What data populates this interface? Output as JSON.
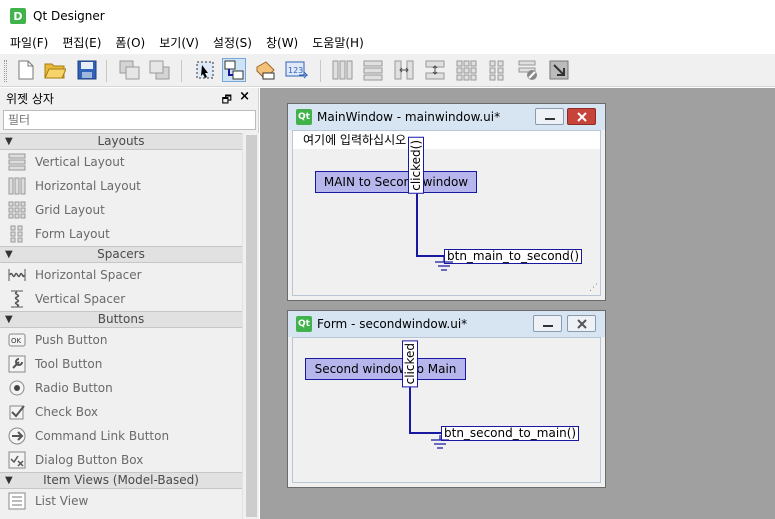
{
  "window": {
    "title": "Qt Designer",
    "icon": "D"
  },
  "menubar": [
    "파일(F)",
    "편집(E)",
    "폼(O)",
    "보기(V)",
    "설정(S)",
    "창(W)",
    "도움말(H)"
  ],
  "widget_box": {
    "title": "위젯 상자",
    "filter_placeholder": "필터",
    "categories": [
      {
        "label": "Layouts",
        "items": [
          "Vertical Layout",
          "Horizontal Layout",
          "Grid Layout",
          "Form Layout"
        ]
      },
      {
        "label": "Spacers",
        "items": [
          "Horizontal Spacer",
          "Vertical Spacer"
        ]
      },
      {
        "label": "Buttons",
        "items": [
          "Push Button",
          "Tool Button",
          "Radio Button",
          "Check Box",
          "Command Link Button",
          "Dialog Button Box"
        ]
      },
      {
        "label": "Item Views (Model-Based)",
        "items": [
          "List View"
        ]
      }
    ]
  },
  "forms": {
    "main": {
      "title": "MainWindow - mainwindow.ui*",
      "menu_placeholder": "여기에 입력하십시오",
      "button_label": "MAIN to Second window",
      "signal": "clicked()",
      "slot": "btn_main_to_second()"
    },
    "second": {
      "title": "Form - secondwindow.ui*",
      "button_label": "Second window to Main",
      "signal": "clicked",
      "slot": "btn_second_to_main()"
    }
  },
  "qt_badge": "Qt"
}
